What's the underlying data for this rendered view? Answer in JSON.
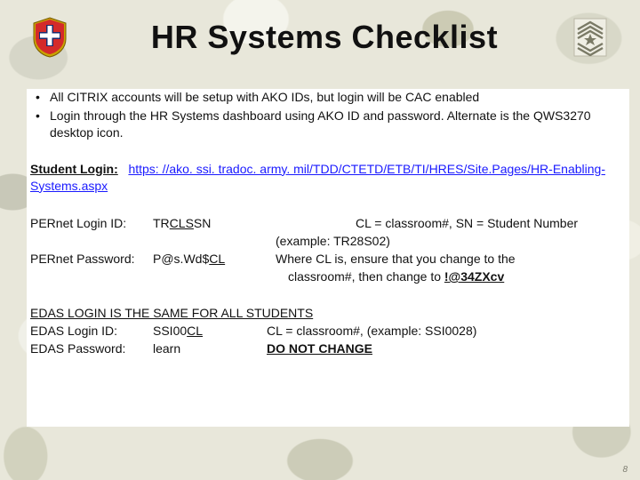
{
  "title": "HR Systems Checklist",
  "bullets": [
    "All CITRIX accounts will be setup with AKO IDs, but login will be CAC enabled",
    "Login through the HR Systems dashboard using AKO ID and password. Alternate is the QWS3270 desktop icon."
  ],
  "student_login": {
    "label": "Student Login:",
    "url_plain": "https: //ako. ssi. tradoc. army. mil/TDD/CTETD/ETB/TI/HRES/Site.Pages/HR-Enabling-Systems.aspx"
  },
  "pernet": {
    "id_label": "PERnet Login ID:",
    "id_prefix": "TR",
    "id_ul": "CLS",
    "id_suffix": "SN",
    "pw_label": "PERnet Password:",
    "pw_prefix": "P@s.Wd$",
    "pw_ul": "CL",
    "note1": "CL = classroom#, SN = Student Number",
    "note2": "(example: TR28S02)",
    "note3_a": "Where CL is, ensure that you change to the",
    "note3_b": "classroom#, then change to ",
    "note3_c": "!@34ZXcv"
  },
  "edas": {
    "header": "EDAS LOGIN IS THE SAME FOR ALL STUDENTS",
    "id_label": "EDAS Login ID:",
    "id_prefix": "SSI00",
    "id_ul": "CL",
    "pw_label": "EDAS Password:",
    "pw_value": "learn",
    "note1": "CL = classroom#, (example: SSI0028)",
    "note2": "DO NOT CHANGE"
  },
  "page_num": "8"
}
